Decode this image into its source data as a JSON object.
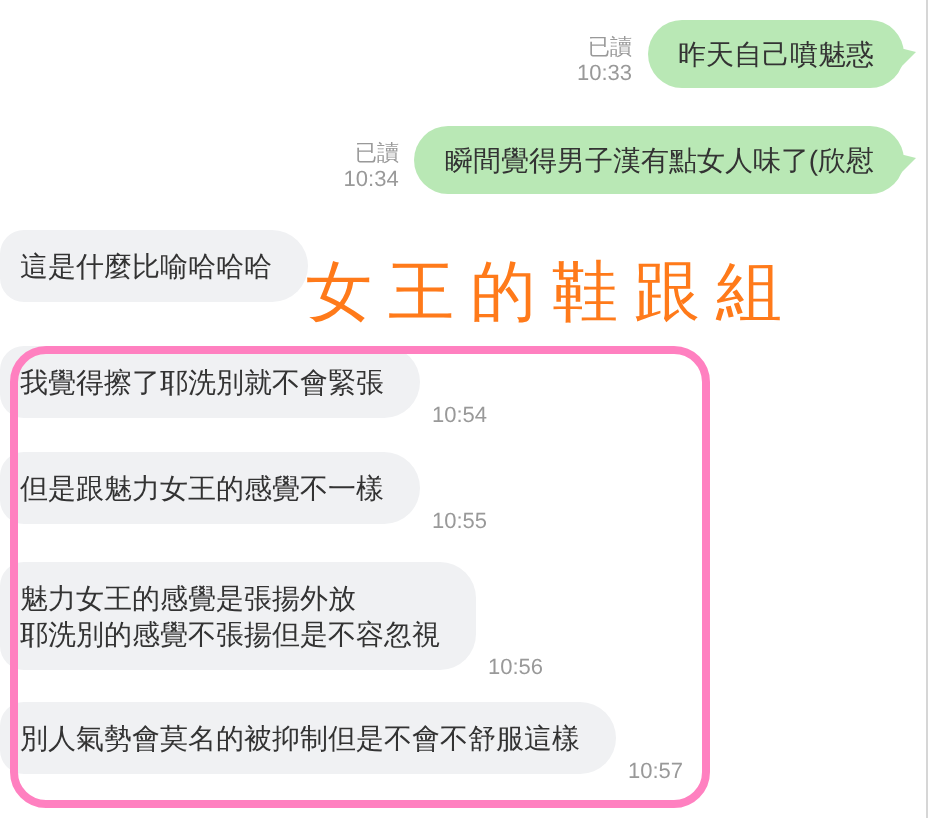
{
  "messages": [
    {
      "kind": "sent",
      "lines": [
        "昨天自己噴魅惑"
      ],
      "read": "已讀",
      "time": "10:33"
    },
    {
      "kind": "sent",
      "lines": [
        "瞬間覺得男子漢有點女人味了(欣慰"
      ],
      "read": "已讀",
      "time": "10:34"
    },
    {
      "kind": "received",
      "lines": [
        "這是什麼比喻哈哈哈"
      ]
    },
    {
      "kind": "received",
      "lines": [
        "我覺得擦了耶洗別就不會緊張"
      ],
      "time": "10:54"
    },
    {
      "kind": "received",
      "lines": [
        "但是跟魅力女王的感覺不一樣"
      ],
      "time": "10:55"
    },
    {
      "kind": "received",
      "lines": [
        "魅力女王的感覺是張揚外放",
        "耶洗別的感覺不張揚但是不容忽視"
      ],
      "time": "10:56"
    },
    {
      "kind": "received",
      "lines": [
        "別人氣勢會莫名的被抑制但是不會不舒服這樣"
      ],
      "time": "10:57"
    }
  ],
  "annotation": {
    "text": "女王的鞋跟組"
  }
}
